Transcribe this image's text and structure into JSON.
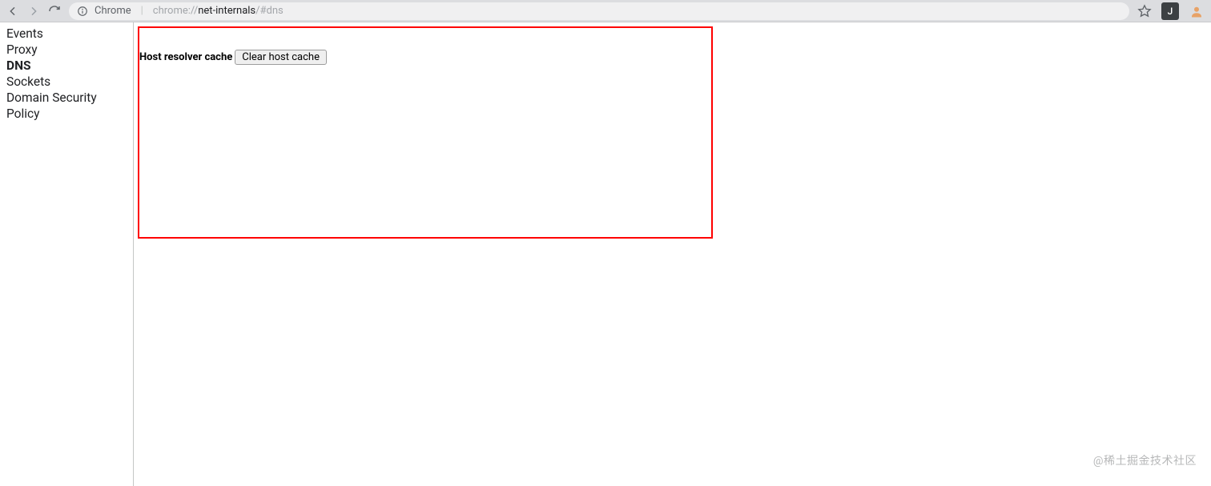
{
  "toolbar": {
    "prefix_label": "Chrome",
    "url_dim_left": "chrome://",
    "url_bold": "net-internals",
    "url_dim_right": "/#dns",
    "profile_initial": "J"
  },
  "sidebar": {
    "items": [
      {
        "label": "Events",
        "active": false
      },
      {
        "label": "Proxy",
        "active": false
      },
      {
        "label": "DNS",
        "active": true
      },
      {
        "label": "Sockets",
        "active": false
      },
      {
        "label": "Domain Security Policy",
        "active": false
      }
    ]
  },
  "main": {
    "cache_label": "Host resolver cache",
    "clear_button_label": "Clear host cache"
  },
  "watermark": "@稀土掘金技术社区"
}
